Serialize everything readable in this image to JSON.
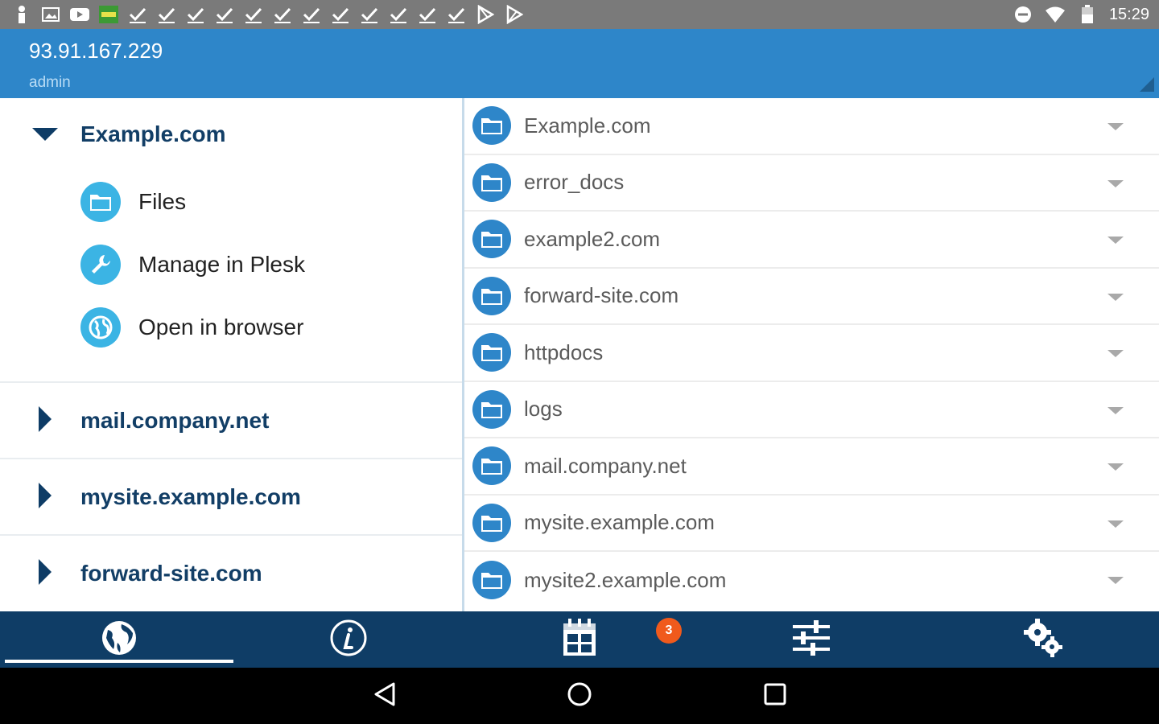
{
  "status_bar": {
    "time": "15:29",
    "left_icons": [
      "person-icon",
      "image-icon",
      "youtube-icon",
      "battery-app-icon",
      "check-icon",
      "check-icon",
      "check-icon",
      "check-icon",
      "check-icon",
      "check-icon",
      "check-icon",
      "check-icon",
      "check-icon",
      "check-icon",
      "check-icon",
      "check-icon",
      "play-store-icon",
      "play-store-icon"
    ],
    "right_icons": [
      "do-not-disturb-icon",
      "wifi-icon",
      "battery-icon"
    ]
  },
  "header": {
    "host": "93.91.167.229",
    "user": "admin"
  },
  "sidebar": {
    "expanded": {
      "title": "Example.com",
      "items": [
        {
          "label": "Files",
          "icon": "folder-icon"
        },
        {
          "label": "Manage in Plesk",
          "icon": "wrench-icon"
        },
        {
          "label": "Open in browser",
          "icon": "globe-icon"
        }
      ]
    },
    "collapsed": [
      {
        "title": "mail.company.net"
      },
      {
        "title": "mysite.example.com"
      },
      {
        "title": "forward-site.com"
      }
    ]
  },
  "files": [
    {
      "name": "Example.com"
    },
    {
      "name": "error_docs"
    },
    {
      "name": "example2.com"
    },
    {
      "name": "forward-site.com"
    },
    {
      "name": "httpdocs"
    },
    {
      "name": "logs"
    },
    {
      "name": "mail.company.net"
    },
    {
      "name": "mysite.example.com"
    },
    {
      "name": "mysite2.example.com"
    }
  ],
  "tabs": {
    "items": [
      "globe-icon",
      "info-icon",
      "calendar-icon",
      "sliders-icon",
      "gears-icon"
    ],
    "active": 0,
    "badge": "3"
  },
  "colors": {
    "app_bar": "#2e86c9",
    "tab_bar": "#0f3d66",
    "title_text": "#123e66",
    "accent_light": "#3bb4e4",
    "badge": "#f05a1c"
  }
}
